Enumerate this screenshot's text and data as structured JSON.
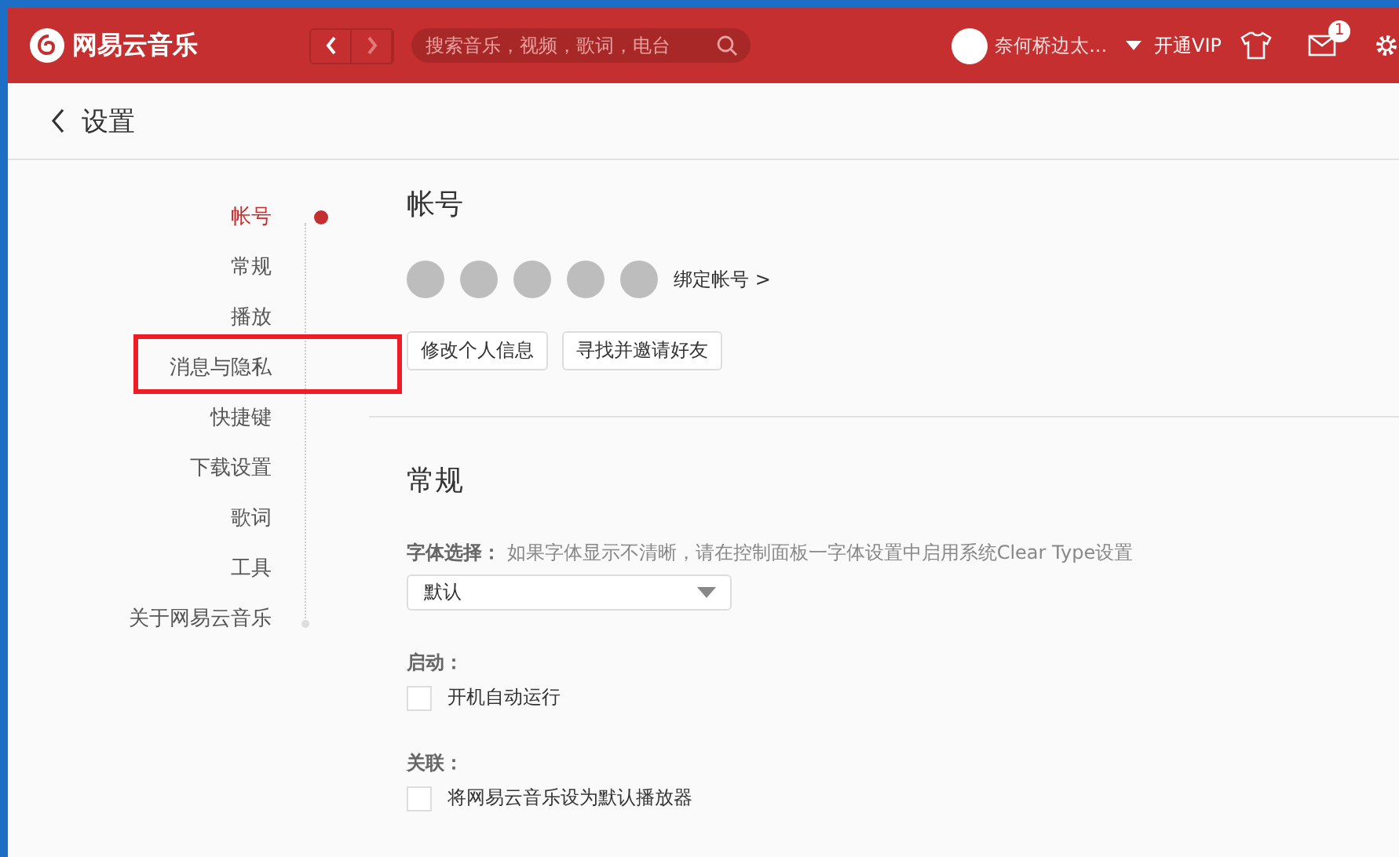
{
  "header": {
    "app_name": "网易云音乐",
    "search": {
      "placeholder": "搜索音乐，视频，歌词，电台"
    },
    "user_name": "奈何桥边太...",
    "vip": "开通VIP",
    "mail_badge": "1"
  },
  "page": {
    "title": "设置"
  },
  "nav": [
    {
      "label": "帐号",
      "selected": true
    },
    {
      "label": "常规",
      "selected": false
    },
    {
      "label": "播放",
      "selected": false
    },
    {
      "label": "消息与隐私",
      "selected": false
    },
    {
      "label": "快捷键",
      "selected": false
    },
    {
      "label": "下载设置",
      "selected": false
    },
    {
      "label": "歌词",
      "selected": false
    },
    {
      "label": "工具",
      "selected": false
    },
    {
      "label": "关于网易云音乐",
      "selected": false
    }
  ],
  "account": {
    "heading": "帐号",
    "bind_link": "绑定帐号 >",
    "buttons": [
      "修改个人信息",
      "寻找并邀请好友"
    ]
  },
  "general": {
    "heading": "常规",
    "font_label": "字体选择：",
    "font_hint": "如果字体显示不清晰，请在控制面板一字体设置中启用系统Clear Type设置",
    "font_value": "默认",
    "groups": [
      {
        "label": "启动：",
        "option": "开机自动运行",
        "checked": false
      },
      {
        "label": "关联：",
        "option": "将网易云音乐设为默认播放器",
        "checked": false
      }
    ]
  }
}
